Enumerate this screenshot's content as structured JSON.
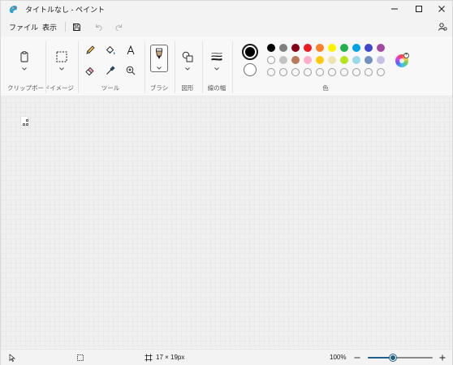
{
  "window": {
    "title": "タイトルなし - ペイント"
  },
  "menu": {
    "file": "ファイル",
    "view": "表示"
  },
  "quick_access": {
    "save_icon": "save-icon",
    "undo_icon": "undo-icon",
    "redo_icon": "redo-icon"
  },
  "ribbon": {
    "groups": {
      "clipboard": "クリップボード",
      "image": "イメージ",
      "tools": "ツール",
      "brushes": "ブラシ",
      "shapes": "図形",
      "stroke_width": "線の幅",
      "colors": "色"
    }
  },
  "colors": {
    "primary": "#000000",
    "secondary": "#ffffff",
    "palette_row1": [
      "#000000",
      "#7f7f7f",
      "#880015",
      "#ed1c24",
      "#ff7f27",
      "#fff200",
      "#22b14c",
      "#00a2e8",
      "#3f48cc",
      "#a349a4"
    ],
    "palette_row2": [
      "#ffffff",
      "#c3c3c3",
      "#b97a57",
      "#ffaec9",
      "#ffc90e",
      "#efe4b0",
      "#b5e61d",
      "#99d9ea",
      "#7092be",
      "#c8bfe7"
    ],
    "palette_row3_count": 10,
    "accent": "#1f5f8c"
  },
  "status": {
    "image_size": "17 × 19px",
    "zoom": "100%"
  }
}
